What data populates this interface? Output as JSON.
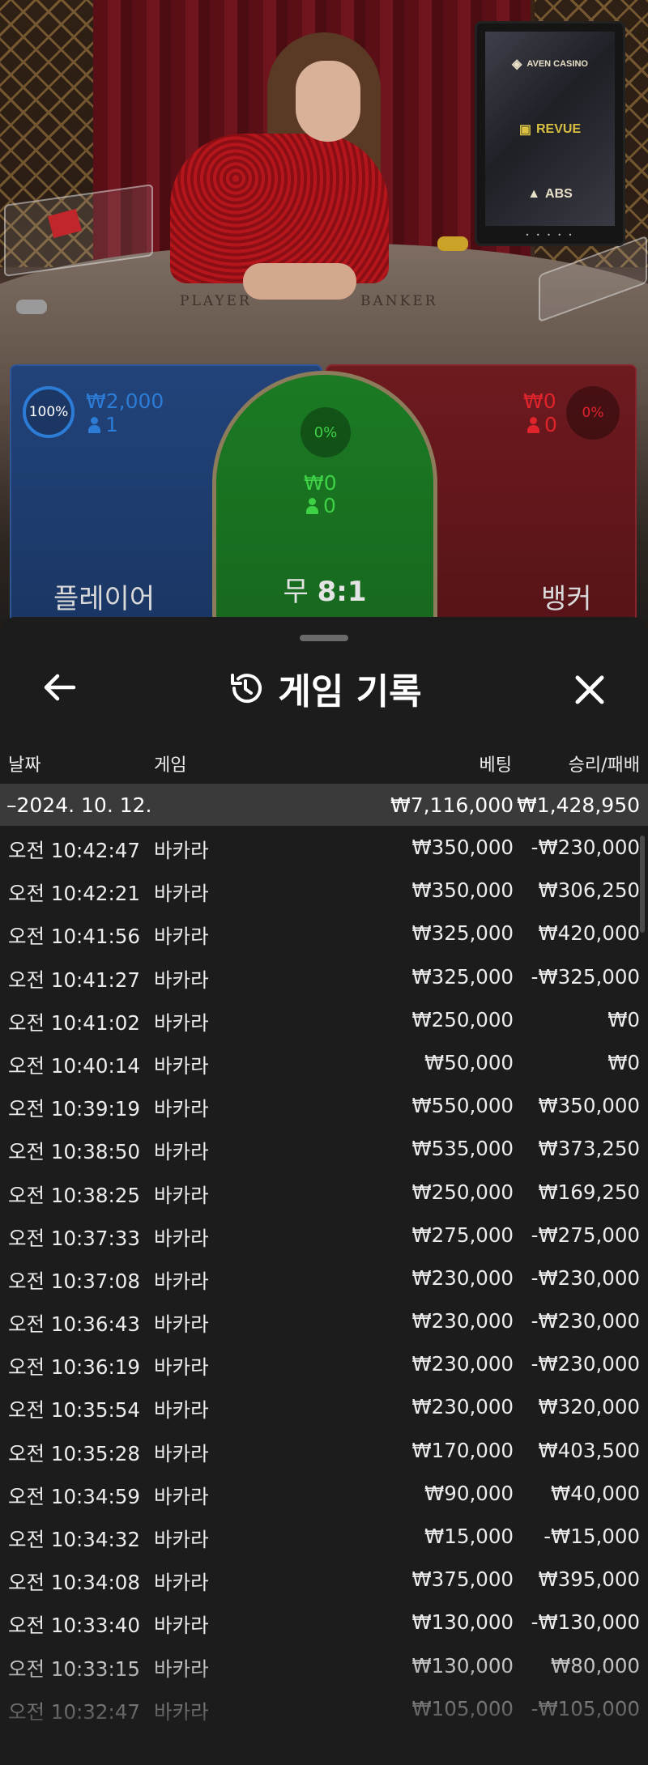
{
  "video": {
    "table_player_text": "PLAYER",
    "table_banker_text": "BANKER",
    "sponsors": [
      "AVEN CASINO",
      "REVUE",
      "ABS"
    ]
  },
  "bets": {
    "player": {
      "label": "플레이어",
      "percent": "100%",
      "amount": "₩2,000",
      "count": "1",
      "color": "#2c7cd6"
    },
    "tie": {
      "label": "무",
      "payout": "8:1",
      "percent": "0%",
      "amount": "₩0",
      "count": "0",
      "color": "#3ed146"
    },
    "banker": {
      "label": "뱅커",
      "percent": "0%",
      "amount": "₩0",
      "count": "0",
      "color": "#e0242c"
    }
  },
  "history": {
    "title": "게임 기록",
    "icons": {
      "back": "back-arrow-icon",
      "title": "history-icon",
      "close": "close-icon"
    },
    "columns": {
      "date": "날짜",
      "game": "게임",
      "bet": "베팅",
      "win_loss": "승리/패배"
    },
    "summary": {
      "date": "–2024. 10. 12.",
      "bet": "₩7,116,000",
      "win_loss": "₩1,428,950"
    },
    "rows": [
      {
        "time": "오전 10:42:47",
        "game": "바카라",
        "bet": "₩350,000",
        "win_loss": "-₩230,000"
      },
      {
        "time": "오전 10:42:21",
        "game": "바카라",
        "bet": "₩350,000",
        "win_loss": "₩306,250"
      },
      {
        "time": "오전 10:41:56",
        "game": "바카라",
        "bet": "₩325,000",
        "win_loss": "₩420,000"
      },
      {
        "time": "오전 10:41:27",
        "game": "바카라",
        "bet": "₩325,000",
        "win_loss": "-₩325,000"
      },
      {
        "time": "오전 10:41:02",
        "game": "바카라",
        "bet": "₩250,000",
        "win_loss": "₩0"
      },
      {
        "time": "오전 10:40:14",
        "game": "바카라",
        "bet": "₩50,000",
        "win_loss": "₩0"
      },
      {
        "time": "오전 10:39:19",
        "game": "바카라",
        "bet": "₩550,000",
        "win_loss": "₩350,000"
      },
      {
        "time": "오전 10:38:50",
        "game": "바카라",
        "bet": "₩535,000",
        "win_loss": "₩373,250"
      },
      {
        "time": "오전 10:38:25",
        "game": "바카라",
        "bet": "₩250,000",
        "win_loss": "₩169,250"
      },
      {
        "time": "오전 10:37:33",
        "game": "바카라",
        "bet": "₩275,000",
        "win_loss": "-₩275,000"
      },
      {
        "time": "오전 10:37:08",
        "game": "바카라",
        "bet": "₩230,000",
        "win_loss": "-₩230,000"
      },
      {
        "time": "오전 10:36:43",
        "game": "바카라",
        "bet": "₩230,000",
        "win_loss": "-₩230,000"
      },
      {
        "time": "오전 10:36:19",
        "game": "바카라",
        "bet": "₩230,000",
        "win_loss": "-₩230,000"
      },
      {
        "time": "오전 10:35:54",
        "game": "바카라",
        "bet": "₩230,000",
        "win_loss": "₩320,000"
      },
      {
        "time": "오전 10:35:28",
        "game": "바카라",
        "bet": "₩170,000",
        "win_loss": "₩403,500"
      },
      {
        "time": "오전 10:34:59",
        "game": "바카라",
        "bet": "₩90,000",
        "win_loss": "₩40,000"
      },
      {
        "time": "오전 10:34:32",
        "game": "바카라",
        "bet": "₩15,000",
        "win_loss": "-₩15,000"
      },
      {
        "time": "오전 10:34:08",
        "game": "바카라",
        "bet": "₩375,000",
        "win_loss": "₩395,000"
      },
      {
        "time": "오전 10:33:40",
        "game": "바카라",
        "bet": "₩130,000",
        "win_loss": "-₩130,000"
      },
      {
        "time": "오전 10:33:15",
        "game": "바카라",
        "bet": "₩130,000",
        "win_loss": "₩80,000"
      },
      {
        "time": "오전 10:32:47",
        "game": "바카라",
        "bet": "₩105,000",
        "win_loss": "-₩105,000"
      }
    ]
  }
}
